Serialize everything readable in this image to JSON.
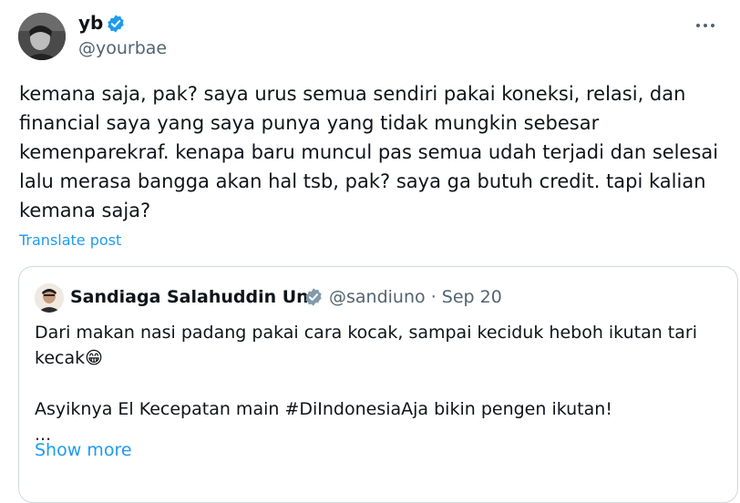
{
  "post": {
    "author_name": "yb",
    "author_handle": "@yourbae",
    "text": "kemana saja, pak? saya urus semua sendiri pakai koneksi, relasi, dan\nfinancial saya yang saya punya yang tidak mungkin sebesar\nkemenparekraf. kenapa baru muncul pas semua udah terjadi dan selesai\nlalu merasa bangga akan hal tsb, pak? saya ga butuh credit. tapi kalian\nkemana saja?",
    "translate_label": "Translate post",
    "more_icon": "ellipsis-icon",
    "verified_icon": "verified-badge-icon"
  },
  "quote": {
    "author_name": "Sandiaga Salahuddin Uno",
    "author_handle": "@sandiuno",
    "separator": "·",
    "date": "Sep 20",
    "text": "Dari makan nasi padang pakai cara kocak, sampai keciduk heboh ikutan tari\nkecak😁\n\nAsyiknya El Kecepatan main #DiIndonesiaAja bikin pengen ikutan!\n...",
    "show_more_label": "Show more"
  },
  "colors": {
    "accent": "#1d9bf0",
    "text": "#0f1419",
    "secondary": "#536471",
    "border": "#cfd9de"
  }
}
